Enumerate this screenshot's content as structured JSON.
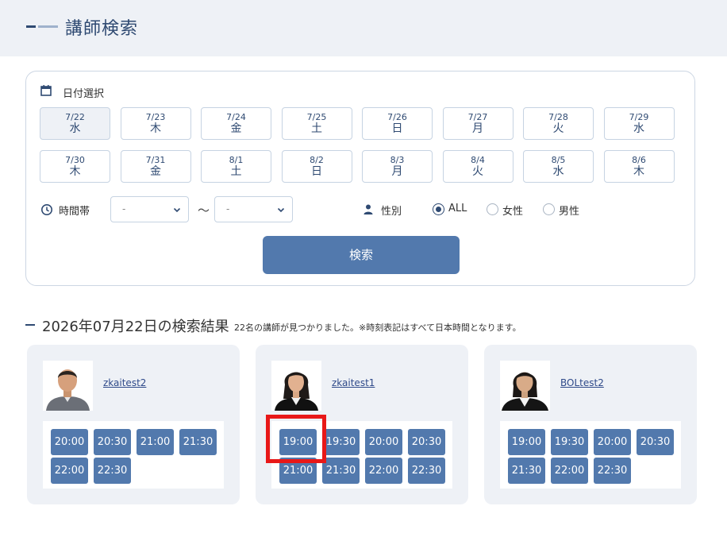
{
  "header": {
    "title": "講師検索"
  },
  "search": {
    "date_label": "日付選択",
    "dates": [
      {
        "date": "7/22",
        "weekday": "水"
      },
      {
        "date": "7/23",
        "weekday": "木"
      },
      {
        "date": "7/24",
        "weekday": "金"
      },
      {
        "date": "7/25",
        "weekday": "土"
      },
      {
        "date": "7/26",
        "weekday": "日"
      },
      {
        "date": "7/27",
        "weekday": "月"
      },
      {
        "date": "7/28",
        "weekday": "火"
      },
      {
        "date": "7/29",
        "weekday": "水"
      },
      {
        "date": "7/30",
        "weekday": "木"
      },
      {
        "date": "7/31",
        "weekday": "金"
      },
      {
        "date": "8/1",
        "weekday": "土"
      },
      {
        "date": "8/2",
        "weekday": "日"
      },
      {
        "date": "8/3",
        "weekday": "月"
      },
      {
        "date": "8/4",
        "weekday": "火"
      },
      {
        "date": "8/5",
        "weekday": "水"
      },
      {
        "date": "8/6",
        "weekday": "木"
      }
    ],
    "selected_date_index": 0,
    "time_label": "時間帯",
    "time_from": "-",
    "time_to": "-",
    "time_separator": "～",
    "gender_label": "性別",
    "gender_options": [
      "ALL",
      "女性",
      "男性"
    ],
    "gender_selected_index": 0,
    "search_button": "検索",
    "icons": [
      "calendar-icon",
      "clock-icon",
      "person-icon",
      "chevron-down-icon"
    ]
  },
  "results": {
    "title": "2026年07月22日の検索結果",
    "note": "22名の講師が見つかりました。※時刻表記はすべて日本時間となります。",
    "teachers": [
      {
        "name": "zkaitest2",
        "slots": [
          "20:00",
          "20:30",
          "21:00",
          "21:30",
          "22:00",
          "22:30"
        ]
      },
      {
        "name": "zkaitest1",
        "slots": [
          "19:00",
          "19:30",
          "20:00",
          "20:30",
          "21:00",
          "21:30",
          "22:00",
          "22:30"
        ]
      },
      {
        "name": "BOLtest2",
        "slots": [
          "19:00",
          "19:30",
          "20:00",
          "20:30",
          "21:30",
          "22:00",
          "22:30"
        ]
      }
    ]
  },
  "colors": {
    "accent": "#5279ad",
    "title": "#2f4a72",
    "panel_bg": "#eef1f6",
    "highlight": "#e81818"
  }
}
